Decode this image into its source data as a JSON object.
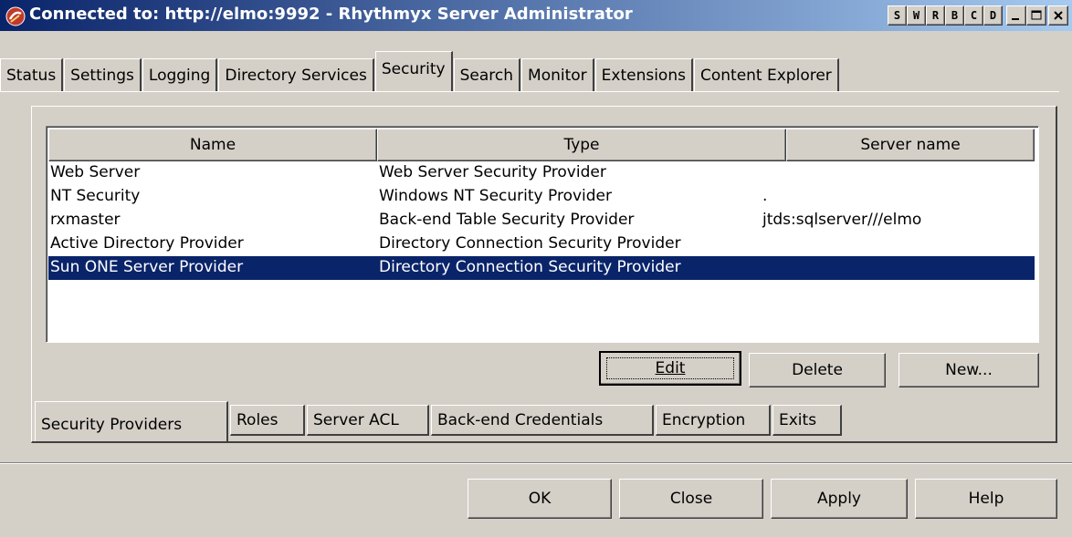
{
  "window": {
    "title": "Connected to: http://elmo:9992 - Rhythmyx Server Administrator",
    "letter_buttons": [
      "S",
      "W",
      "R",
      "B",
      "C",
      "D"
    ],
    "accent": "#0a246a"
  },
  "top_tabs": [
    "Status",
    "Settings",
    "Logging",
    "Directory Services",
    "Security",
    "Search",
    "Monitor",
    "Extensions",
    "Content Explorer"
  ],
  "active_top_tab": "Security",
  "table": {
    "columns": [
      "Name",
      "Type",
      "Server name"
    ],
    "rows": [
      {
        "name": "Web Server",
        "type": "Web Server Security Provider",
        "server": ""
      },
      {
        "name": "NT Security",
        "type": "Windows NT Security Provider",
        "server": "."
      },
      {
        "name": "rxmaster",
        "type": "Back-end Table Security Provider",
        "server": "jtds:sqlserver///elmo"
      },
      {
        "name": "Active Directory Provider",
        "type": "Directory Connection Security Provider",
        "server": ""
      },
      {
        "name": "Sun ONE Server Provider",
        "type": "Directory Connection Security Provider",
        "server": ""
      }
    ],
    "selected_row": 4
  },
  "panel_buttons": {
    "edit": "Edit",
    "delete": "Delete",
    "new": "New..."
  },
  "bottom_tabs": [
    "Security Providers",
    "Roles",
    "Server ACL",
    "Back-end Credentials",
    "Encryption",
    "Exits"
  ],
  "active_bottom_tab": "Security Providers",
  "dialog_buttons": {
    "ok": "OK",
    "close": "Close",
    "apply": "Apply",
    "help": "Help"
  }
}
